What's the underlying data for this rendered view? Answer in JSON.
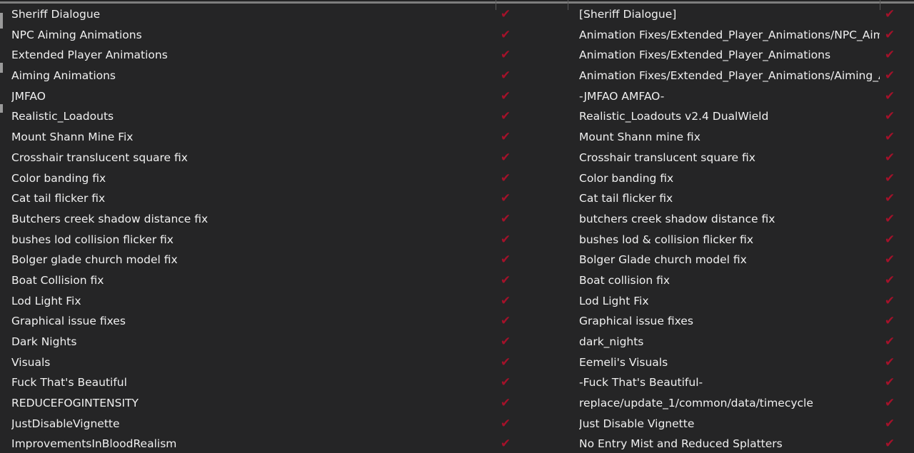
{
  "check_color": "#a3122a",
  "check_icon": "checkmark-icon",
  "rows": [
    {
      "name": "Sheriff Dialogue",
      "target": "[Sheriff Dialogue]"
    },
    {
      "name": "NPC Aiming Animations",
      "target": "Animation Fixes/Extended_Player_Animations/NPC_Aiming_"
    },
    {
      "name": "Extended Player Animations",
      "target": "Animation Fixes/Extended_Player_Animations"
    },
    {
      "name": "Aiming Animations",
      "target": "Animation Fixes/Extended_Player_Animations/Aiming_Anim"
    },
    {
      "name": "JMFAO",
      "target": "-JMFAO AMFAO-"
    },
    {
      "name": "Realistic_Loadouts",
      "target": "Realistic_Loadouts v2.4 DualWield"
    },
    {
      "name": "Mount Shann Mine Fix",
      "target": "Mount Shann mine fix"
    },
    {
      "name": "Crosshair translucent square fix",
      "target": "Crosshair translucent square fix"
    },
    {
      "name": "Color banding fix",
      "target": "Color banding fix"
    },
    {
      "name": "Cat tail flicker fix",
      "target": "Cat tail flicker fix"
    },
    {
      "name": "Butchers creek shadow distance fix",
      "target": "butchers creek shadow distance fix"
    },
    {
      "name": "bushes lod collision flicker fix",
      "target": "bushes lod & collision flicker  fix"
    },
    {
      "name": "Bolger glade church model fix",
      "target": "Bolger Glade church model fix"
    },
    {
      "name": "Boat Collision fix",
      "target": "Boat collision fix"
    },
    {
      "name": "Lod Light Fix",
      "target": "Lod Light Fix"
    },
    {
      "name": "Graphical issue fixes",
      "target": "Graphical issue fixes"
    },
    {
      "name": "Dark Nights",
      "target": "dark_nights"
    },
    {
      "name": "Visuals",
      "target": "Eemeli's Visuals"
    },
    {
      "name": "Fuck That's Beautiful",
      "target": "-Fuck That's Beautiful-"
    },
    {
      "name": "REDUCEFOGINTENSITY",
      "target": "replace/update_1/common/data/timecycle"
    },
    {
      "name": "JustDisableVignette",
      "target": "Just Disable Vignette"
    },
    {
      "name": "ImprovementsInBloodRealism",
      "target": "No Entry Mist and Reduced Splatters"
    }
  ]
}
